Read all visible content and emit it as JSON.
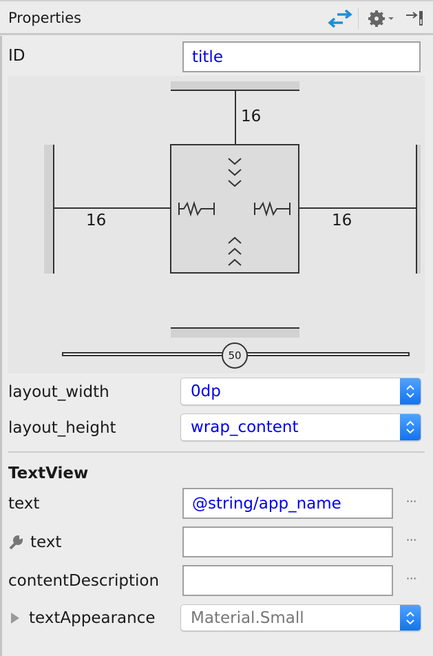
{
  "header": {
    "title": "Properties",
    "icons": [
      "swap-arrows-icon",
      "gear-icon",
      "pin-to-side-icon"
    ]
  },
  "id": {
    "label": "ID",
    "value": "title"
  },
  "constraints": {
    "top_margin": "16",
    "left_margin": "16",
    "right_margin": "16",
    "vertical_bias": "50",
    "bias_percent": 50
  },
  "layout_width": {
    "label": "layout_width",
    "value": "0dp"
  },
  "layout_height": {
    "label": "layout_height",
    "value": "wrap_content"
  },
  "section": {
    "title": "TextView"
  },
  "text": {
    "label": "text",
    "value": "@string/app_name",
    "more": "···"
  },
  "tools_text": {
    "label": "text",
    "value": "",
    "more": "···"
  },
  "content_description": {
    "label": "contentDescription",
    "value": "",
    "more": "···"
  },
  "text_appearance": {
    "label": "textAppearance",
    "value": "Material.Small"
  },
  "colors": {
    "accent": "#1373ee",
    "value_text": "#0000ee",
    "swap_icon": "#1e8fd6"
  }
}
